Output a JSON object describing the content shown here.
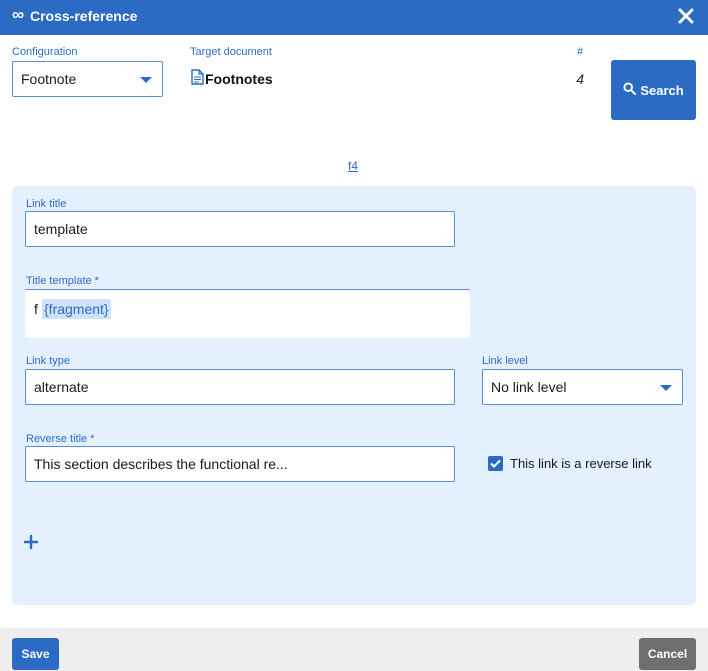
{
  "dialog": {
    "logo_glyph": "∞",
    "title": "Cross-reference",
    "close_icon": "close-icon"
  },
  "top": {
    "configuration_label": "Configuration",
    "configuration_value": "Footnote",
    "target_document_label": "Target document",
    "target_document_value": "Footnotes",
    "target_document_icon": "document-icon",
    "count_label": "#",
    "count_value": "4",
    "search_label": "Search",
    "search_icon": "search-icon"
  },
  "fragment_link": "f4",
  "form": {
    "link_title_label": "Link title",
    "link_title_value": "template",
    "title_template_label": "Title template *",
    "title_template_prefix": "f",
    "title_template_token": "{fragment}",
    "link_type_label": "Link type",
    "link_type_value": "alternate",
    "link_level_label": "Link level",
    "link_level_value": "No link level",
    "reverse_title_label": "Reverse title *",
    "reverse_title_value": "This section describes the functional re...",
    "reverse_link_label": "This link is a reverse link",
    "reverse_link_checked": true,
    "add_icon": "plus-icon"
  },
  "footer": {
    "save_label": "Save",
    "cancel_label": "Cancel"
  },
  "colors": {
    "accent": "#2c6bc4",
    "panel_background": "#e4f0fd",
    "cancel_button": "#6e6e6e",
    "footer_background": "#eeeeee"
  }
}
